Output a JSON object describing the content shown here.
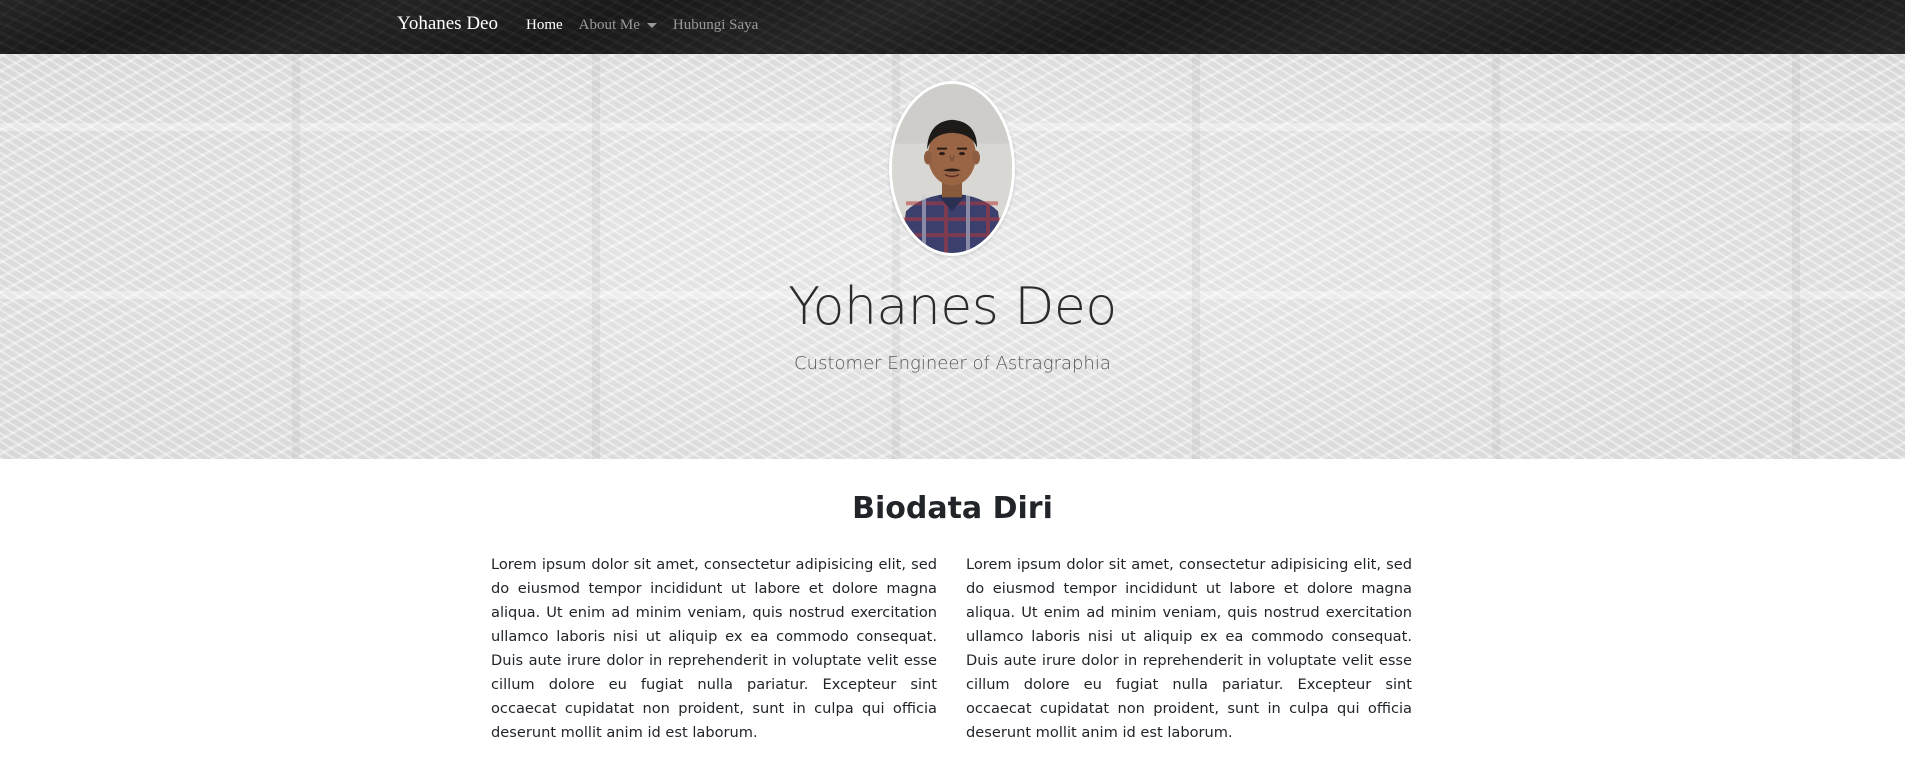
{
  "navbar": {
    "brand": "Yohanes Deo",
    "links": [
      {
        "label": "Home",
        "active": true
      },
      {
        "label": "About Me",
        "dropdown": true
      },
      {
        "label": "Hubungi Saya"
      }
    ]
  },
  "hero": {
    "name": "Yohanes Deo",
    "subtitle": "Customer Engineer of Astragraphia"
  },
  "biodata": {
    "title": "Biodata Diri",
    "paragraphs": [
      "Lorem ipsum dolor sit amet, consectetur adipisicing elit, sed do eiusmod tempor incididunt ut labore et dolore magna aliqua. Ut enim ad minim veniam, quis nostrud exercitation ullamco laboris nisi ut aliquip ex ea commodo consequat. Duis aute irure dolor in reprehenderit in voluptate velit esse cillum dolore eu fugiat nulla pariatur. Excepteur sint occaecat cupidatat non proident, sunt in culpa qui officia deserunt mollit anim id est laborum.",
      "Lorem ipsum dolor sit amet, consectetur adipisicing elit, sed do eiusmod tempor incididunt ut labore et dolore magna aliqua. Ut enim ad minim veniam, quis nostrud exercitation ullamco laboris nisi ut aliquip ex ea commodo consequat. Duis aute irure dolor in reprehenderit in voluptate velit esse cillum dolore eu fugiat nulla pariatur. Excepteur sint occaecat cupidatat non proident, sunt in culpa qui officia deserunt mollit anim id est laborum."
    ]
  },
  "colors": {
    "navbar_bg": "#1b1b1b",
    "nav_active": "#ffffff",
    "nav_inactive": "#9a9a9a",
    "hero_bg": "#ebebeb",
    "text": "#212529"
  },
  "icons": {
    "dropdown": "caret-down-icon"
  }
}
